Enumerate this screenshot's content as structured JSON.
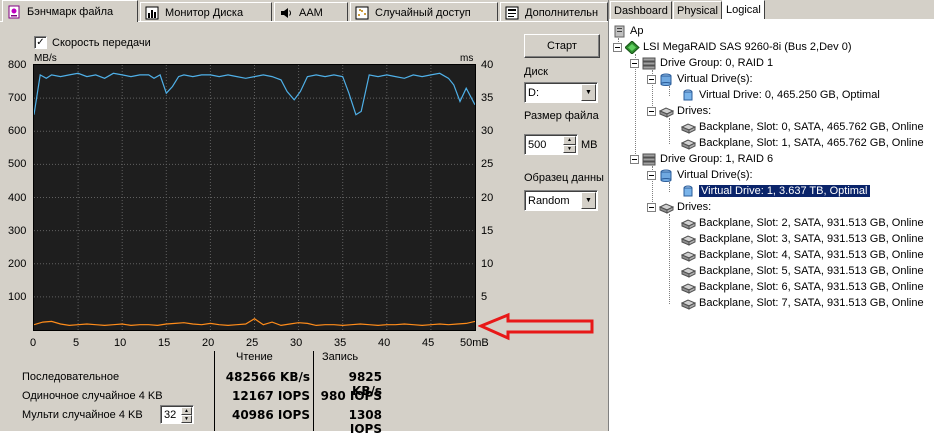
{
  "tabs": [
    {
      "label": "Бэнчмарк файла",
      "icon": "benchmark-icon"
    },
    {
      "label": "Монитор Диска",
      "icon": "monitor-chart-icon"
    },
    {
      "label": "AAM",
      "icon": "speaker-icon"
    },
    {
      "label": "Случайный доступ",
      "icon": "random-access-icon"
    },
    {
      "label": "Дополнительн",
      "icon": "extra-icon"
    }
  ],
  "transfer_speed_label": "Скорость передачи",
  "chart_data": {
    "type": "line",
    "left_unit": "MB/s",
    "right_unit": "ms",
    "x_ticks": [
      "0",
      "5",
      "10",
      "15",
      "20",
      "25",
      "30",
      "35",
      "40",
      "45",
      "50mB"
    ],
    "y_left_ticks": [
      "800",
      "700",
      "600",
      "500",
      "400",
      "300",
      "200",
      "100"
    ],
    "y_right_ticks": [
      "40",
      "35",
      "30",
      "25",
      "20",
      "15",
      "10",
      "5"
    ],
    "ylim_left": [
      0,
      800
    ],
    "ylim_right": [
      0,
      40
    ],
    "xlim": [
      0,
      50
    ],
    "series": [
      {
        "unit": "MB/s",
        "color": "#4fb0e8",
        "x": [
          0,
          0.7,
          1.4,
          2,
          3,
          4,
          5,
          6,
          7,
          8,
          9,
          10,
          11,
          12,
          13,
          13.6,
          14.3,
          15,
          15.7,
          16.4,
          17,
          18,
          19,
          20,
          21,
          22,
          23,
          24,
          25,
          26,
          27,
          28,
          28.7,
          29.5,
          30.2,
          31,
          32,
          33,
          34,
          35,
          35.7,
          36.5,
          37.1,
          38,
          39,
          40,
          41,
          42,
          43,
          44,
          45,
          46,
          47,
          47.6,
          48.3,
          49,
          50
        ],
        "y": [
          650,
          770,
          760,
          770,
          765,
          770,
          775,
          765,
          770,
          760,
          775,
          770,
          765,
          770,
          770,
          760,
          770,
          715,
          735,
          765,
          770,
          765,
          770,
          770,
          765,
          770,
          765,
          760,
          765,
          770,
          765,
          755,
          720,
          695,
          720,
          765,
          770,
          765,
          770,
          765,
          715,
          650,
          660,
          770,
          765,
          770,
          765,
          760,
          770,
          765,
          770,
          775,
          760,
          740,
          690,
          730,
          680
        ]
      },
      {
        "unit": "ms",
        "color": "#ff8c1a",
        "x": [
          0,
          1,
          2,
          3,
          4,
          5,
          6,
          7,
          8,
          9,
          10,
          11,
          12,
          13,
          14,
          15,
          16,
          17,
          18,
          19,
          20,
          21,
          22,
          23,
          24,
          25,
          26,
          27,
          28,
          29,
          30,
          31,
          32,
          33,
          34,
          35,
          36,
          37,
          38,
          39,
          40,
          41,
          42,
          43,
          44,
          45,
          46,
          47,
          48,
          49,
          50
        ],
        "y": [
          0.8,
          1.2,
          1.3,
          0.9,
          0.7,
          0.8,
          0.9,
          0.8,
          0.7,
          0.8,
          0.9,
          0.7,
          0.8,
          0.8,
          0.7,
          0.9,
          1.0,
          1.1,
          0.9,
          0.8,
          1.0,
          0.8,
          0.7,
          0.8,
          0.9,
          1.7,
          0.8,
          1.2,
          0.7,
          0.9,
          1.1,
          1.0,
          0.7,
          0.8,
          0.8,
          0.7,
          0.8,
          0.9,
          0.8,
          0.7,
          0.8,
          0.8,
          0.9,
          0.8,
          0.7,
          0.8,
          0.9,
          0.8,
          0.9,
          1.0,
          1.3
        ]
      }
    ]
  },
  "controls": {
    "start_label": "Старт",
    "disk_label": "Диск",
    "disk_value": "D:",
    "file_size_label": "Размер файла",
    "file_size_value": "500",
    "file_size_unit": "MB",
    "pattern_label": "Образец данны",
    "pattern_value": "Random"
  },
  "results": {
    "headers": {
      "read": "Чтение",
      "write": "Запись"
    },
    "rows": [
      {
        "label": "Последовательное",
        "read": "482566 KB/s",
        "write": "9825 KB/s"
      },
      {
        "label": "Одиночное случайное 4 KB",
        "read": "12167 IOPS",
        "write": "980 IOPS"
      },
      {
        "label": "Мульти случайное 4 KB",
        "read": "40986 IOPS",
        "write": "1308 IOPS"
      }
    ],
    "queue_depth": "32"
  },
  "annotation": {
    "arrow_color": "#e81818"
  },
  "right_tabs": [
    "Dashboard",
    "Physical",
    "Logical"
  ],
  "tree": [
    {
      "label": "Ap",
      "icon": "server-icon"
    },
    {
      "label": "LSI MegaRAID SAS 9260-8i (Bus 2,Dev 0)",
      "icon": "controller-icon"
    },
    {
      "label": "Drive Group: 0, RAID  1",
      "icon": "drive-group-icon"
    },
    {
      "label": "Virtual Drive(s):",
      "icon": "virtual-drives-icon"
    },
    {
      "label": "Virtual Drive: 0, 465.250 GB, Optimal",
      "icon": "virtual-drive-icon"
    },
    {
      "label": "Drives:",
      "icon": "drives-icon"
    },
    {
      "label": "Backplane, Slot: 0, SATA, 465.762 GB, Online",
      "icon": "hdd-icon"
    },
    {
      "label": "Backplane, Slot: 1, SATA, 465.762 GB, Online",
      "icon": "hdd-icon"
    },
    {
      "label": "Drive Group: 1, RAID  6",
      "icon": "drive-group-icon"
    },
    {
      "label": "Virtual Drive(s):",
      "icon": "virtual-drives-icon"
    },
    {
      "label": "Virtual Drive: 1, 3.637 TB, Optimal",
      "icon": "virtual-drive-icon",
      "selected": true
    },
    {
      "label": "Drives:",
      "icon": "drives-icon"
    },
    {
      "label": "Backplane, Slot: 2, SATA, 931.513 GB, Online",
      "icon": "hdd-icon"
    },
    {
      "label": "Backplane, Slot: 3, SATA, 931.513 GB, Online",
      "icon": "hdd-icon"
    },
    {
      "label": "Backplane, Slot: 4, SATA, 931.513 GB, Online",
      "icon": "hdd-icon"
    },
    {
      "label": "Backplane, Slot: 5, SATA, 931.513 GB, Online",
      "icon": "hdd-icon"
    },
    {
      "label": "Backplane, Slot: 6, SATA, 931.513 GB, Online",
      "icon": "hdd-icon"
    },
    {
      "label": "Backplane, Slot: 7, SATA, 931.513 GB, Online",
      "icon": "hdd-icon"
    }
  ]
}
